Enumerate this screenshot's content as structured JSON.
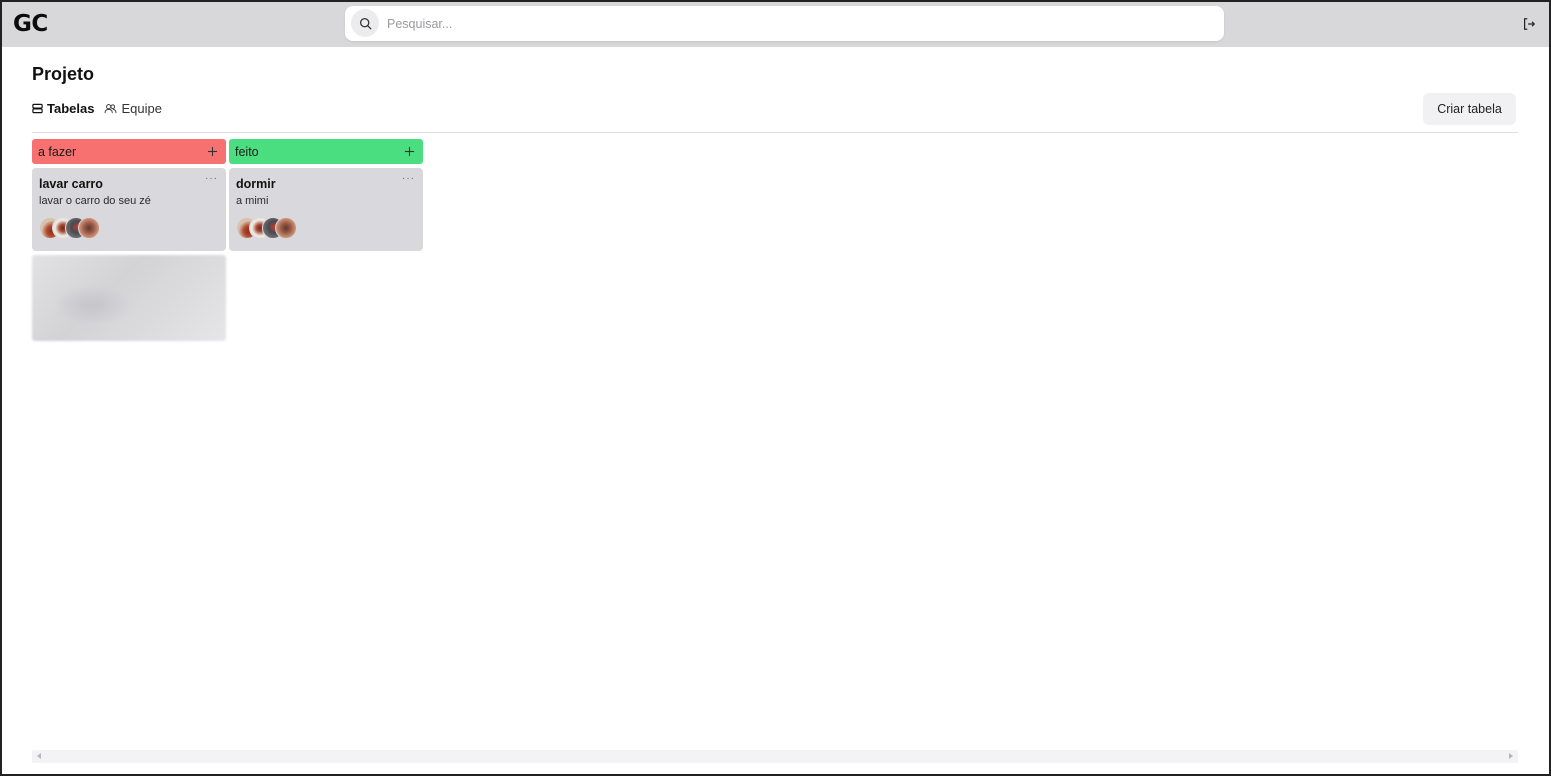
{
  "header": {
    "logo": "GC",
    "search_placeholder": "Pesquisar..."
  },
  "page": {
    "title": "Projeto",
    "tabs": [
      {
        "label": "Tabelas",
        "icon": "table-icon",
        "active": true
      },
      {
        "label": "Equipe",
        "icon": "users-icon",
        "active": false
      }
    ],
    "create_button": "Criar tabela"
  },
  "columns": [
    {
      "title": "a fazer",
      "color": "#f87171",
      "cards": [
        {
          "title": "lavar carro",
          "description": "lavar o carro do seu zé",
          "members": 4
        }
      ]
    },
    {
      "title": "feito",
      "color": "#4ade80",
      "cards": [
        {
          "title": "dormir",
          "description": "a mimi",
          "members": 4
        }
      ]
    }
  ],
  "colors": {
    "header_bg": "#d8d8db",
    "card_bg": "#d9d9dd"
  }
}
